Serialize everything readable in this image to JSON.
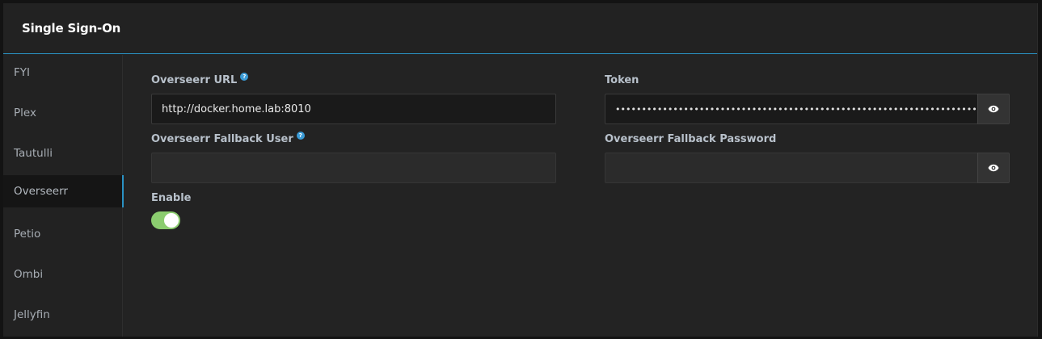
{
  "header": {
    "title": "Single Sign-On"
  },
  "sidebar": {
    "items": [
      {
        "label": "FYI"
      },
      {
        "label": "Plex"
      },
      {
        "label": "Tautulli"
      },
      {
        "label": "Overseerr"
      },
      {
        "label": "Petio"
      },
      {
        "label": "Ombi"
      },
      {
        "label": "Jellyfin"
      }
    ],
    "active": "Overseerr"
  },
  "form": {
    "url_label": "Overseerr URL",
    "url_value": "http://docker.home.lab:8010",
    "token_label": "Token",
    "token_value": "••••••••••••••••••••••••••••••••••••••••••••••••••••••••••••••••••••••••••••••••••••••••••",
    "fallback_user_label": "Overseerr Fallback User",
    "fallback_user_value": "",
    "fallback_password_label": "Overseerr Fallback Password",
    "fallback_password_value": "",
    "enable_label": "Enable",
    "enable_value": true,
    "help_glyph": "?"
  },
  "colors": {
    "accent": "#2a91c3",
    "toggle_on": "#8bcd6f"
  },
  "icons": {
    "show_password": "eye-icon",
    "help": "help-icon"
  }
}
